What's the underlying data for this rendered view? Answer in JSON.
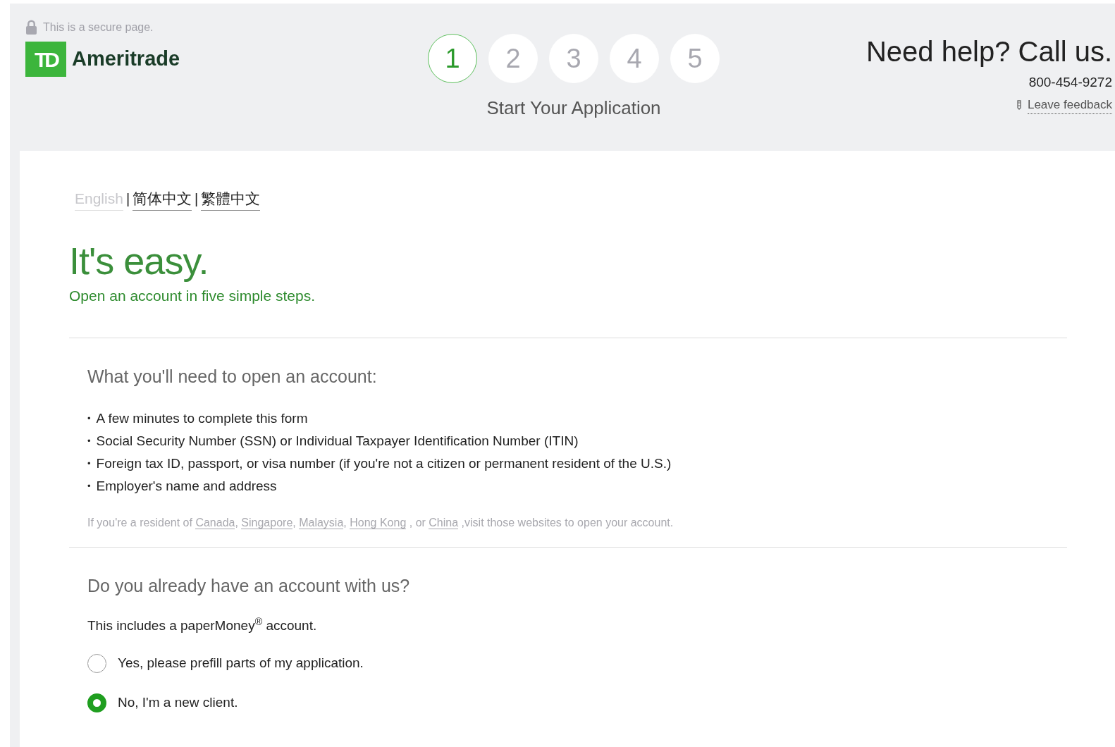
{
  "header": {
    "secure_note": "This is a secure page.",
    "logo_mark": "TD",
    "logo_text": "Ameritrade",
    "steps": [
      {
        "label": "1",
        "selected": true
      },
      {
        "label": "2",
        "selected": false
      },
      {
        "label": "3",
        "selected": false
      },
      {
        "label": "4",
        "selected": false
      },
      {
        "label": "5",
        "selected": false
      }
    ],
    "step_title": "Start Your Application",
    "help_title": "Need help? Call us.",
    "phone": "800-454-9272",
    "feedback_link": "Leave feedback"
  },
  "languages": [
    {
      "label": "English",
      "selected": true
    },
    {
      "label": "简体中文",
      "selected": false
    },
    {
      "label": "繁體中文",
      "selected": false
    }
  ],
  "language_separator": "|",
  "hero": {
    "title": "It's easy.",
    "subtitle": "Open an account in five simple steps."
  },
  "requirements": {
    "title": "What you'll need to open an account:",
    "bullet": "•",
    "items": [
      "A few minutes to complete this form",
      "Social Security Number (SSN) or Individual Taxpayer Identification Number (ITIN)",
      "Foreign tax ID, passport, or visa number (if you're not a citizen or permanent resident of the U.S.)",
      "Employer's name and address"
    ],
    "resident_note": [
      {
        "kind": "text",
        "text": "If you're a resident of"
      },
      {
        "kind": "link",
        "text": "Canada"
      },
      {
        "kind": "text",
        "text": ","
      },
      {
        "kind": "link",
        "text": "Singapore"
      },
      {
        "kind": "text",
        "text": ","
      },
      {
        "kind": "link",
        "text": "Malaysia"
      },
      {
        "kind": "text",
        "text": ","
      },
      {
        "kind": "link",
        "text": "Hong Kong"
      },
      {
        "kind": "text",
        "text": ", or"
      },
      {
        "kind": "link",
        "text": "China"
      },
      {
        "kind": "text",
        "text": ",visit those websites to open your account."
      }
    ]
  },
  "existing_account": {
    "title": "Do you already have an account with us?",
    "note": "This includes a paperMoney$^{®}$ account.",
    "options": [
      {
        "label": "Yes, please prefill parts of my application.",
        "selected": false
      },
      {
        "label": "No, I'm a new client.",
        "selected": true
      }
    ]
  }
}
